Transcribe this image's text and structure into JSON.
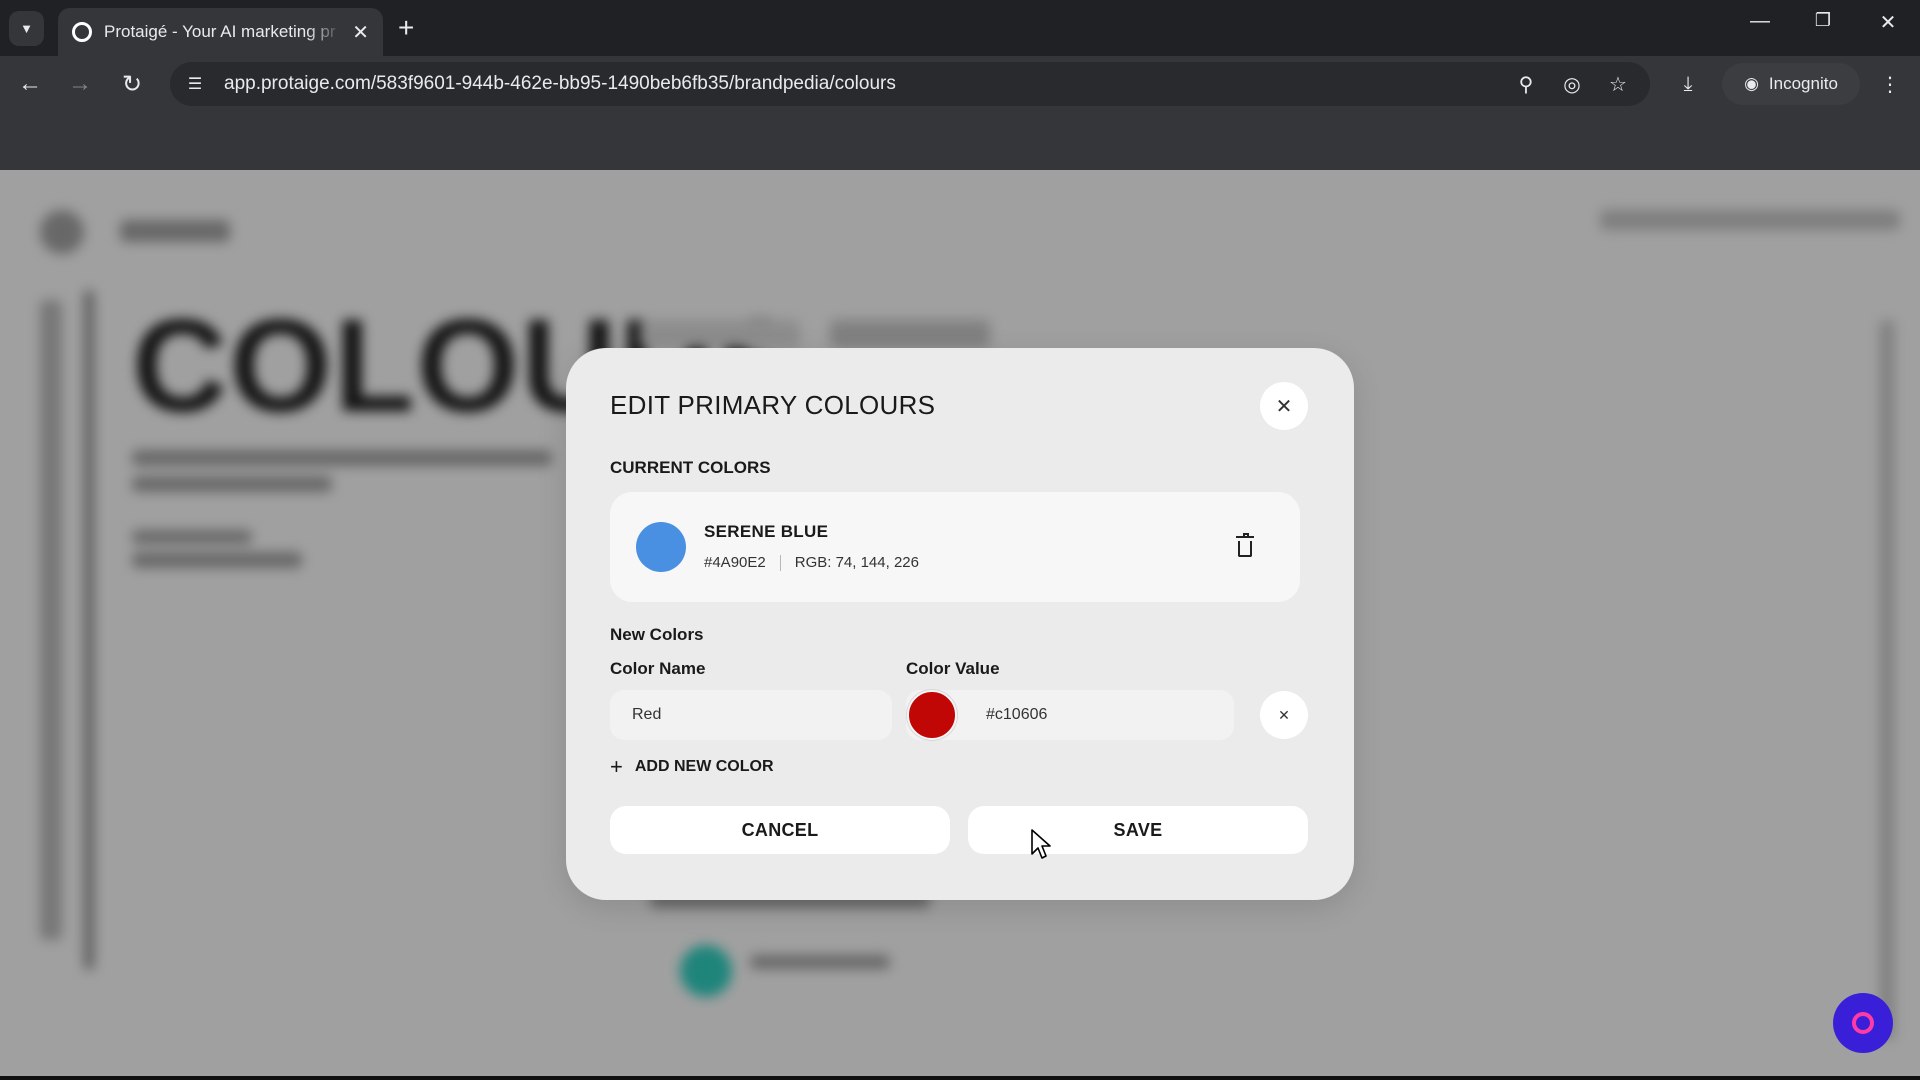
{
  "browser": {
    "tab_title": "Protaigé - Your AI marketing pr",
    "url": "app.protaige.com/583f9601-944b-462e-bb95-1490beb6fb35/brandpedia/colours",
    "incognito_label": "Incognito"
  },
  "background": {
    "heading": "COLOURS"
  },
  "modal": {
    "title": "EDIT PRIMARY COLOURS",
    "current_label": "CURRENT COLORS",
    "current_colors": [
      {
        "name": "SERENE BLUE",
        "hex": "#4A90E2",
        "rgb": "RGB: 74, 144, 226",
        "swatch": "#4A90E2"
      }
    ],
    "new_label": "New Colors",
    "color_name_label": "Color Name",
    "color_value_label": "Color Value",
    "new_color": {
      "name": "Red",
      "value": "#c10606",
      "swatch": "#c10606"
    },
    "add_label": "ADD NEW COLOR",
    "cancel_label": "CANCEL",
    "save_label": "SAVE"
  },
  "icons": {
    "tab_search": "chevron-down-icon",
    "favicon": "protaige-logo-icon",
    "zoom": "magnifier-icon",
    "tracking": "eye-slash-icon",
    "bookmark": "star-icon",
    "download": "download-icon",
    "incognito": "incognito-icon",
    "menu": "kebab-menu-icon",
    "trash": "trash-icon",
    "close": "close-icon",
    "chat": "chat-launcher-icon"
  }
}
